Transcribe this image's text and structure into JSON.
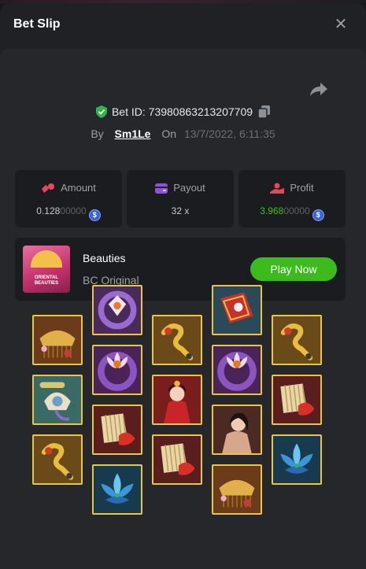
{
  "modal": {
    "title": "Bet Slip"
  },
  "bet": {
    "id_label": "Bet ID: 73980863213207709",
    "by_label": "By",
    "user": "Sm1Le",
    "on_label": "On",
    "datetime": "13/7/2022, 6:11:35"
  },
  "stats": {
    "amount": {
      "label": "Amount",
      "value_main": "0.128",
      "value_dim": "00000"
    },
    "payout": {
      "label": "Payout",
      "value": "32 x"
    },
    "profit": {
      "label": "Profit",
      "value_main": "3.968",
      "value_dim": "00000"
    }
  },
  "game": {
    "name": "Beauties",
    "subtitle": "BC Original",
    "play_label": "Play Now",
    "thumb_text": "ORIENTAL BEAUTIES"
  },
  "colors": {
    "accent_green": "#3cba1e",
    "tile_border": "#e8c547",
    "bg": "#1f2124"
  },
  "reels": [
    [
      "comb",
      "bamboo-flute",
      "jade-hairpin"
    ],
    [
      "fan-charm",
      "lotus-ring",
      "silk-fan",
      "blue-lotus"
    ],
    [
      "jade-hairpin",
      "beauty-red",
      "silk-fan"
    ],
    [
      "red-fan-book",
      "lotus-ring",
      "beauty-dark",
      "comb"
    ],
    [
      "jade-hairpin",
      "silk-fan",
      "blue-lotus"
    ]
  ],
  "icons": {
    "close": "close-icon",
    "share": "share-icon",
    "shield": "shield-check-icon",
    "copy": "copy-icon",
    "coin": "coin-icon"
  }
}
